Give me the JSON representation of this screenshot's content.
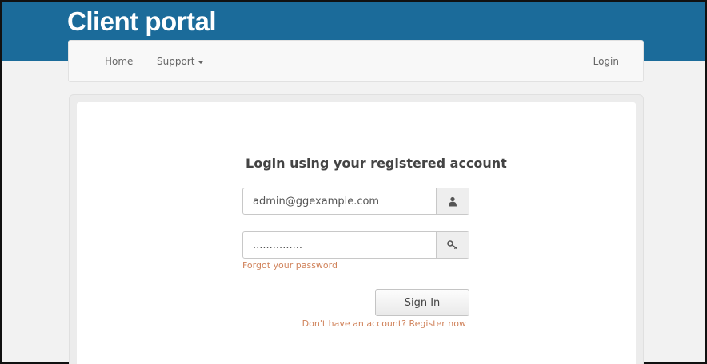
{
  "header": {
    "brand": "Client portal"
  },
  "nav": {
    "home": "Home",
    "support": "Support",
    "login": "Login"
  },
  "login_form": {
    "title": "Login using your registered account",
    "email_value": "admin@ggexample.com",
    "password_value": "...............",
    "email_icon": "user-icon",
    "password_icon": "key-icon",
    "forgot_link": "Forgot your password",
    "signin_button": "Sign In",
    "register_link": "Don't have an account? Register now"
  },
  "colors": {
    "header_band": "#1b6b9a",
    "link_accent": "#d0825a"
  }
}
